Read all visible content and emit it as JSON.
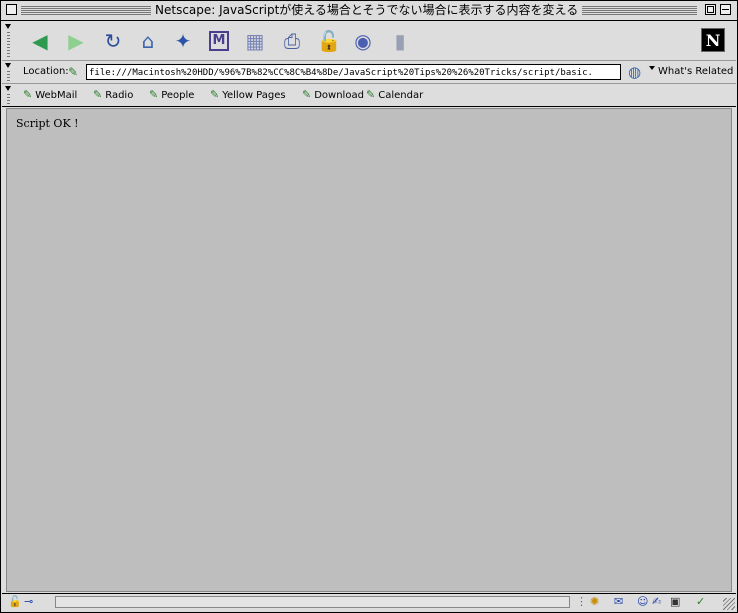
{
  "window": {
    "title": "Netscape: JavaScriptが使える場合とそうでない場合に表示する内容を変える"
  },
  "toolbar": {
    "buttons": [
      {
        "name": "back",
        "icon": "back-arrow-icon",
        "glyph": "◀",
        "color": "#2e9a50"
      },
      {
        "name": "forward",
        "icon": "forward-arrow-icon",
        "glyph": "▶",
        "color": "#8fcf8f"
      },
      {
        "name": "reload",
        "icon": "reload-icon",
        "glyph": "↻",
        "color": "#2b4c9a"
      },
      {
        "name": "home",
        "icon": "home-icon",
        "glyph": "⌂",
        "color": "#3a64b0"
      },
      {
        "name": "search",
        "icon": "search-icon",
        "glyph": "✦",
        "color": "#2a54a8"
      },
      {
        "name": "my-netscape",
        "icon": "my-netscape-icon",
        "glyph": "M",
        "color": "#4a3f8f"
      },
      {
        "name": "images",
        "icon": "images-icon",
        "glyph": "▦",
        "color": "#7a86b8"
      },
      {
        "name": "print",
        "icon": "print-icon",
        "glyph": "⎙",
        "color": "#4a5fa0"
      },
      {
        "name": "security",
        "icon": "security-lock-icon",
        "glyph": "🔓",
        "color": "#c03a3a"
      },
      {
        "name": "shop",
        "icon": "shop-icon",
        "glyph": "◉",
        "color": "#4a5fb0"
      },
      {
        "name": "stop",
        "icon": "stop-icon",
        "glyph": "▮",
        "color": "#9aa0b4"
      }
    ]
  },
  "location": {
    "label": "Location:",
    "url": "file:///Macintosh%20HDD/%96%7B%82%CC%8C%B4%8De/JavaScript%20Tips%20%26%20Tricks/script/basic.",
    "related_label": "What's Related"
  },
  "personal_toolbar": {
    "items": [
      "WebMail",
      "Radio",
      "People",
      "Yellow Pages",
      "Download",
      "Calendar"
    ]
  },
  "content": {
    "text": "Script OK !"
  },
  "colors": {
    "chrome": "#dddddd",
    "content_background": "#bebebe"
  }
}
